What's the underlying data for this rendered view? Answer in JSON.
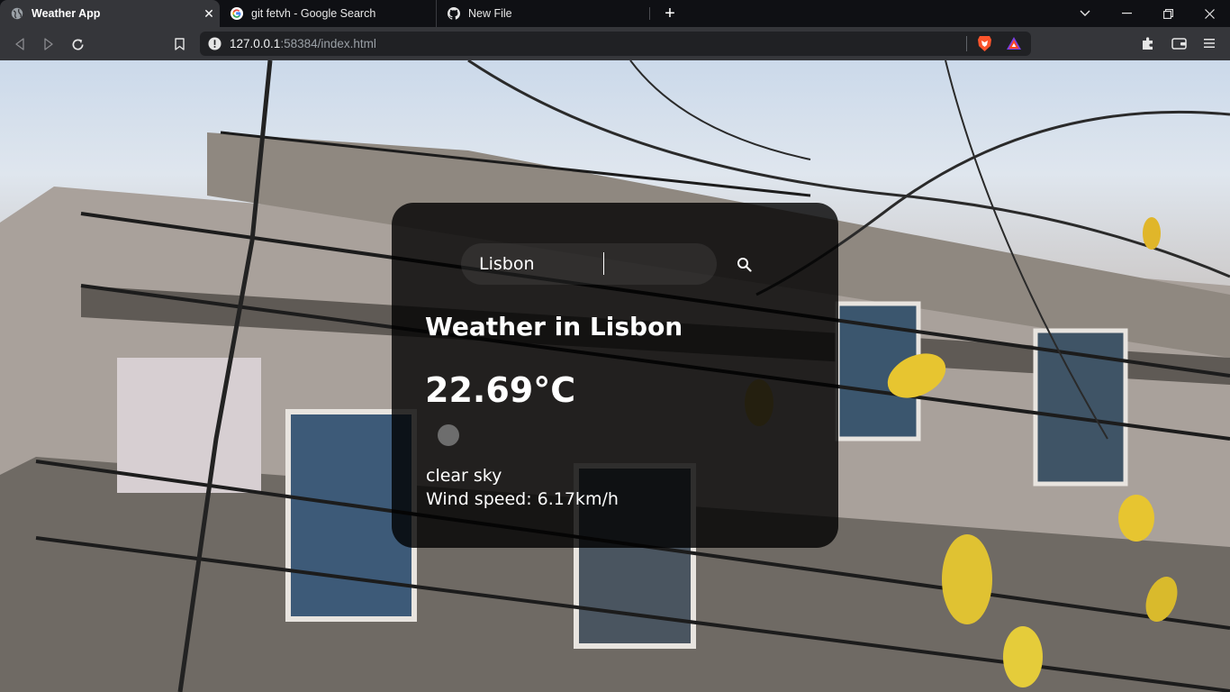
{
  "browser": {
    "tabs": [
      {
        "label": "Weather App",
        "active": true,
        "favicon": "globe-icon"
      },
      {
        "label": "git fetvh - Google Search",
        "active": false,
        "favicon": "google-icon"
      },
      {
        "label": "New File",
        "active": false,
        "favicon": "github-icon"
      }
    ],
    "close_glyph": "✕",
    "new_tab_glyph": "+",
    "window_controls": {
      "dropdown": "⌄",
      "minimize": "–",
      "restore": "❐",
      "close": "✕"
    },
    "address": {
      "host": "127.0.0.1",
      "rest": ":58384/index.html"
    }
  },
  "weather": {
    "search_value": "Lisbon",
    "search_placeholder": "Search",
    "city_heading": "Weather in Lisbon",
    "temperature": "22.69°C",
    "description": "clear sky",
    "wind": "Wind speed: 6.17km/h"
  },
  "colors": {
    "card_bg": "rgba(0,0,0,0.80)",
    "tab_strip": "#0f1014",
    "toolbar": "#35363a",
    "brave_orange": "#fb542b"
  }
}
